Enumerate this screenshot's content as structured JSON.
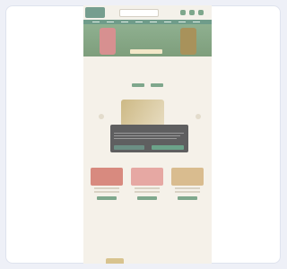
{
  "site": {
    "logo_text": "",
    "hero_title": "",
    "section_heading": "",
    "section_subline": "",
    "cookie": {
      "title": "",
      "body": "",
      "reject_label": "",
      "accept_label": ""
    },
    "features_heading": "",
    "footer_heading": ""
  },
  "colors": {
    "page_bg": "#f5f1e9",
    "accent": "#7ea78c",
    "hero": "#8fb090",
    "cookie_bg": "#5f5f60"
  }
}
